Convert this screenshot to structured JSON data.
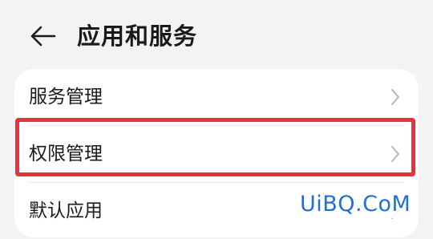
{
  "header": {
    "back_icon": "arrow-left-icon",
    "title": "应用和服务"
  },
  "list": {
    "items": [
      {
        "label": "服务管理",
        "icon": "chevron-right-icon"
      },
      {
        "label": "权限管理",
        "icon": "chevron-right-icon",
        "highlighted": true
      },
      {
        "label": "默认应用",
        "icon": "chevron-right-icon"
      }
    ]
  },
  "overlay": {
    "highlight_color": "#e8323a",
    "watermark_text": "UiBQ.CoM",
    "watermark_color": "#1f6fd6"
  }
}
